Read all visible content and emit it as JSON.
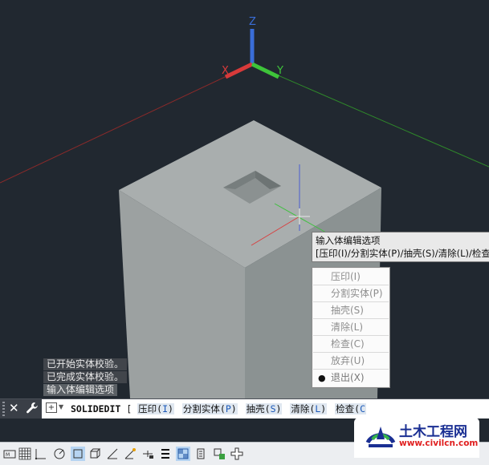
{
  "viewport": {
    "axis_labels": {
      "x": "X",
      "y": "Y",
      "z": "Z"
    },
    "colors": {
      "background": "#212830",
      "axis_x": "#d83a3a",
      "axis_y": "#3ec43a",
      "axis_z": "#3a6ed8",
      "cube_top": "#a8adad",
      "cube_left": "#9aa0a0",
      "cube_right": "#889090"
    }
  },
  "command_history": [
    "已开始实体校验。",
    "已完成实体校验。",
    "输入体编辑选项"
  ],
  "tooltip": {
    "title": "输入体编辑选项",
    "options_line": "[压印(I)/分割实体(P)/抽壳(S)/清除(L)/检查(C)/放弃(U)/退出(X)]"
  },
  "context_menu": {
    "items": [
      {
        "label": "压印(I)"
      },
      {
        "label": "分割实体(P)"
      },
      {
        "label": "抽壳(S)"
      },
      {
        "label": "清除(L)"
      },
      {
        "label": "检查(C)"
      },
      {
        "label": "放弃(U)"
      },
      {
        "label": "退出(X)",
        "selected": true
      }
    ],
    "bullet": "●"
  },
  "command_line": {
    "close_icon": "close-icon",
    "settings_icon": "wrench-icon",
    "command": "SOLIDEDIT",
    "open_bracket": "[",
    "options": [
      {
        "text": "压印(",
        "key": "I",
        "end": ")"
      },
      {
        "text": "分割实体(",
        "key": "P",
        "end": ")"
      },
      {
        "text": "抽壳(",
        "key": "S",
        "end": ")"
      },
      {
        "text": "清除(",
        "key": "L",
        "end": ")"
      },
      {
        "text": "检查(",
        "key": "C",
        "end": ""
      }
    ]
  },
  "statusbar": {
    "icons": [
      "model-icon",
      "grid-icon",
      "snap-icon",
      "ortho-icon",
      "polar-icon",
      "osnap-icon",
      "3dosnap-icon",
      "otrack-icon",
      "ducs-icon",
      "dyn-icon",
      "lineweight-icon",
      "transparency-icon",
      "selection-cycling-icon",
      "annotation-icon",
      "workspace-icon",
      "add-icon"
    ]
  },
  "watermark": {
    "title": "土木工程网",
    "url": "www.civilcn.com",
    "colors": {
      "title": "#1a2f93",
      "url": "#e02020"
    }
  }
}
